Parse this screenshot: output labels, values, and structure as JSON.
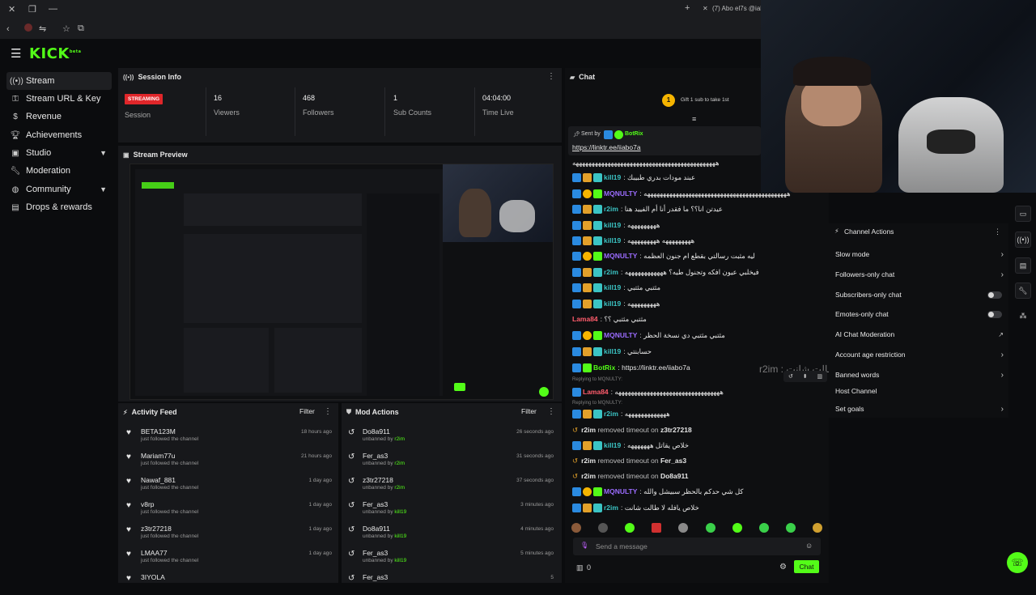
{
  "browser": {
    "tab_title": "(7) Abo el7s @iabo",
    "new_tab": "+"
  },
  "header": {
    "logo": "KICK",
    "logo_tag": "beta"
  },
  "sidebar": {
    "items": [
      {
        "label": "Stream",
        "icon": "broadcast-icon"
      },
      {
        "label": "Stream URL & Key",
        "icon": "key-icon"
      },
      {
        "label": "Revenue",
        "icon": "dollar-icon"
      },
      {
        "label": "Achievements",
        "icon": "trophy-icon"
      },
      {
        "label": "Studio",
        "icon": "studio-icon"
      },
      {
        "label": "Moderation",
        "icon": "wrench-icon"
      },
      {
        "label": "Community",
        "icon": "globe-icon"
      },
      {
        "label": "Drops & rewards",
        "icon": "gift-icon"
      }
    ]
  },
  "session_info": {
    "title": "Session Info",
    "status": "STREAMING",
    "session_label": "Session",
    "stats": [
      {
        "value": "16",
        "label": "Viewers"
      },
      {
        "value": "468",
        "label": "Followers"
      },
      {
        "value": "1",
        "label": "Sub Counts"
      },
      {
        "value": "04:04:00",
        "label": "Time Live"
      }
    ]
  },
  "stream_preview": {
    "title": "Stream Preview"
  },
  "activity_feed": {
    "title": "Activity Feed",
    "filter": "Filter",
    "rows": [
      {
        "name": "BETA123M",
        "sub": "just followed the channel",
        "time": "18 hours ago"
      },
      {
        "name": "Mariam77u",
        "sub": "just followed the channel",
        "time": "21 hours ago"
      },
      {
        "name": "Nawaf_881",
        "sub": "just followed the channel",
        "time": "1 day ago"
      },
      {
        "name": "v8rp",
        "sub": "just followed the channel",
        "time": "1 day ago"
      },
      {
        "name": "z3tr27218",
        "sub": "just followed the channel",
        "time": "1 day ago"
      },
      {
        "name": "LMAA77",
        "sub": "just followed the channel",
        "time": "1 day ago"
      },
      {
        "name": "3IYOLA",
        "sub": "",
        "time": ""
      }
    ]
  },
  "mod_actions": {
    "title": "Mod Actions",
    "filter": "Filter",
    "rows": [
      {
        "name": "Do8a911",
        "action": "unbanned by",
        "by": "r2im",
        "time": "26 seconds ago"
      },
      {
        "name": "Fer_as3",
        "action": "unbanned by",
        "by": "r2im",
        "time": "31 seconds ago"
      },
      {
        "name": "z3tr27218",
        "action": "unbanned by",
        "by": "r2im",
        "time": "37 seconds ago"
      },
      {
        "name": "Fer_as3",
        "action": "unbanned by",
        "by": "kill19",
        "time": "3 minutes ago"
      },
      {
        "name": "Do8a911",
        "action": "unbanned by",
        "by": "kill19",
        "time": "4 minutes ago"
      },
      {
        "name": "Fer_as3",
        "action": "unbanned by",
        "by": "kill19",
        "time": "5 minutes ago"
      },
      {
        "name": "Fer_as3",
        "action": "",
        "by": "",
        "time": "5"
      }
    ]
  },
  "chat": {
    "title": "Chat",
    "gift_count": "1",
    "gift_text": "Gift 1 sub to take 1st",
    "pinned_by_label": "Sent by",
    "pinned_by_user": "BotRix",
    "pinned_link": "https://linktr.ee/iiabo7a",
    "replying_1": "Replying to MQNULTY:",
    "replying_2": "Replying to MQNULTY:",
    "messages": [
      {
        "user": "",
        "color": "#e6e6e6",
        "text": "هههههههههههههههههههههههههههههههههههههههههههههه",
        "badges": []
      },
      {
        "user": "kill19",
        "color": "#3bc4c4",
        "text": ": عبند مودات بدري طبيبك",
        "badges": [
          "b-blue",
          "b-orange",
          "b-cyan"
        ]
      },
      {
        "user": "MQNULTY",
        "color": "#9b6cff",
        "text": ": هههههههههههههههههههههههههههههههههههههههههههههه",
        "badges": [
          "b-blue",
          "b-gold",
          "b-green"
        ]
      },
      {
        "user": "r2im",
        "color": "#3bc4c4",
        "text": ": عيدتن انا؟؟ ما فقدر أنا أم الفييد هنا",
        "badges": [
          "b-blue",
          "b-orange",
          "b-cyan"
        ]
      },
      {
        "user": "kill19",
        "color": "#3bc4c4",
        "text": ": هههههههههه",
        "badges": [
          "b-blue",
          "b-orange",
          "b-cyan"
        ]
      },
      {
        "user": "kill19",
        "color": "#3bc4c4",
        "text": ": هههههههههه هههههههههه",
        "badges": [
          "b-blue",
          "b-orange",
          "b-cyan"
        ]
      },
      {
        "user": "MQNULTY",
        "color": "#9b6cff",
        "text": ": ليه مثبت رسالتي بقطع ام جنون العظمه",
        "badges": [
          "b-blue",
          "b-gold",
          "b-green"
        ]
      },
      {
        "user": "r2im",
        "color": "#3bc4c4",
        "text": ": فيخلبي عيون افكه وتجنول طيه؟ ههههههههههههه",
        "badges": [
          "b-blue",
          "b-orange",
          "b-cyan"
        ]
      },
      {
        "user": "kill19",
        "color": "#3bc4c4",
        "text": ": مثتبي مثتبي",
        "badges": [
          "b-blue",
          "b-orange",
          "b-cyan"
        ]
      },
      {
        "user": "kill19",
        "color": "#3bc4c4",
        "text": ": هههههههههه",
        "badges": [
          "b-blue",
          "b-orange",
          "b-cyan"
        ]
      },
      {
        "user": "Lama84",
        "color": "#ff5c6c",
        "text": ": مثتبي مثتبي ؟؟",
        "badges": []
      },
      {
        "user": "MQNULTY",
        "color": "#9b6cff",
        "text": ": مثتبي مثتبي دي نسخة الحظر",
        "badges": [
          "b-blue",
          "b-gold",
          "b-green"
        ]
      },
      {
        "user": "kill19",
        "color": "#3bc4c4",
        "text": ": حسابنتي",
        "badges": [
          "b-blue",
          "b-orange",
          "b-cyan"
        ]
      },
      {
        "user": "BotRix",
        "color": "#53fc18",
        "text": ": https://linktr.ee/iiabo7a",
        "badges": [
          "b-blue",
          "b-green"
        ]
      },
      {
        "user": "Lama84",
        "color": "#ff5c6c",
        "text": ": هههههههههههههههههههههههههههههههههه",
        "badges": [
          "b-blue"
        ]
      },
      {
        "user": "r2im",
        "color": "#3bc4c4",
        "text": ": هههههههههههههه",
        "badges": [
          "b-blue",
          "b-orange",
          "b-cyan"
        ]
      }
    ],
    "system_1": {
      "actor": "r2im",
      "text": "removed timeout on",
      "target": "z3tr27218"
    },
    "after_sys_1": {
      "user": "kill19",
      "color": "#3bc4c4",
      "text": ": خلاص يقاتل هههههههه",
      "badges": [
        "b-blue",
        "b-orange",
        "b-cyan"
      ]
    },
    "system_2": {
      "actor": "r2im",
      "text": "removed timeout on",
      "target": "Fer_as3"
    },
    "system_3": {
      "actor": "r2im",
      "text": "removed timeout on",
      "target": "Do8a911"
    },
    "tail": [
      {
        "user": "MQNULTY",
        "color": "#9b6cff",
        "text": ": كل شي حدكم بالحظر سبيشل والله",
        "badges": [
          "b-blue",
          "b-gold",
          "b-green"
        ]
      },
      {
        "user": "r2im",
        "color": "#3bc4c4",
        "text": ": خلاص يافله لا طالت شانت",
        "badges": [
          "b-blue",
          "b-orange",
          "b-cyan"
        ]
      }
    ],
    "input_placeholder": "Send a message",
    "count": "0",
    "send_label": "Chat",
    "overlay_text": "r2im : خلاص يافله لا طالت شانت"
  },
  "channel_actions": {
    "title": "Channel Actions",
    "items": [
      {
        "label": "Slow mode",
        "kind": "arrow"
      },
      {
        "label": "Followers-only chat",
        "kind": "arrow"
      },
      {
        "label": "Subscribers-only chat",
        "kind": "toggle"
      },
      {
        "label": "Emotes-only chat",
        "kind": "toggle"
      },
      {
        "label": "AI Chat Moderation",
        "kind": "external"
      },
      {
        "label": "Account age restriction",
        "kind": "arrow"
      },
      {
        "label": "Banned words",
        "kind": "arrow"
      },
      {
        "label": "Host Channel",
        "kind": "none"
      },
      {
        "label": "Set goals",
        "kind": "arrow"
      }
    ]
  },
  "colors": {
    "accent": "#53fc18",
    "streaming": "#e0262a",
    "panel": "#17181b"
  }
}
